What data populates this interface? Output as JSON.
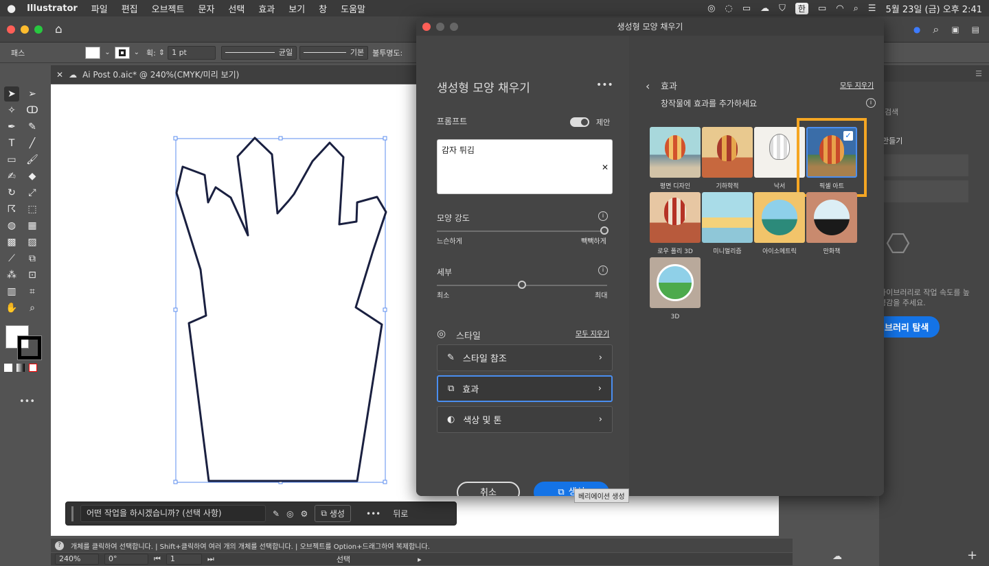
{
  "menubar": {
    "app": "Illustrator",
    "items": [
      "파일",
      "편집",
      "오브젝트",
      "문자",
      "선택",
      "효과",
      "보기",
      "창",
      "도움말"
    ],
    "input_lang": "한",
    "clock": "5월 23일 (금) 오후 2:41"
  },
  "control_bar": {
    "label": "패스",
    "stroke_label": "획:",
    "stroke_value": "1 pt",
    "profile_uniform": "균일",
    "profile_basic": "기본",
    "opacity_label": "불투명도:"
  },
  "document_tab": {
    "title": "Ai Post 0.aic* @ 240%(CMYK/미리 보기)"
  },
  "context_bar": {
    "prompt_placeholder": "어떤 작업을 하시겠습니까? (선택 사항)",
    "generate_label": "생성",
    "more": "•••",
    "back_label": "뒤로"
  },
  "status_bar": {
    "help_text": "개체를 클릭하여 선택합니다.  |  Shift+클릭하여 여러 개의 개체를 선택합니다.  |  오브젝트를 Option+드래그하여 복제합니다."
  },
  "zoom_bar": {
    "zoom": "240%",
    "rotation": "0°",
    "page": "1",
    "mode": "선택"
  },
  "right_panel": {
    "search": "검색",
    "create": "만들기",
    "hint_line1": "라이브러리로 작업 속도를 높",
    "hint_line2": "영감을 주세요.",
    "browse_button": "브러리 탐색"
  },
  "dialog": {
    "window_title": "생성형 모양 채우기",
    "heading": "생성형 모양 채우기",
    "prompt_label": "프롬프트",
    "suggest_label": "제안",
    "prompt_value": "감자 튀김",
    "shape_strength_label": "모양 강도",
    "shape_strength_min": "느슨하게",
    "shape_strength_max": "빽빽하게",
    "shape_strength_value": 1.0,
    "detail_label": "세부",
    "detail_min": "최소",
    "detail_max": "최대",
    "detail_value": 0.5,
    "style_label": "스타일",
    "clear_all": "모두 지우기",
    "style_reference": "스타일 참조",
    "effects": "효과",
    "color_tone": "색상 및 톤",
    "cancel_button": "취소",
    "generate_button": "생성",
    "tooltip": "베리에이션 생성"
  },
  "effects_panel": {
    "title": "효과",
    "clear_all": "모두 지우기",
    "subtitle": "창작물에 효과를 추가하세요",
    "items": [
      {
        "label": "평면 디자인",
        "selected": false
      },
      {
        "label": "기하학적",
        "selected": false
      },
      {
        "label": "낙서",
        "selected": false
      },
      {
        "label": "픽셀 아트",
        "selected": true
      },
      {
        "label": "로우 폴리 3D",
        "selected": false
      },
      {
        "label": "미니멀리즘",
        "selected": false
      },
      {
        "label": "아이소메트릭",
        "selected": false
      },
      {
        "label": "만화책",
        "selected": false
      },
      {
        "label": "3D",
        "selected": false
      }
    ],
    "highlight_color": "#f5a623"
  }
}
